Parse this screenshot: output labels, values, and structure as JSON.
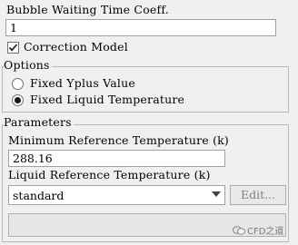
{
  "bubble_waiting": {
    "label": "Bubble Waiting Time Coeff.",
    "value": "1"
  },
  "correction_model": {
    "label": "Correction Model",
    "checked": true
  },
  "options": {
    "title": "Options",
    "radios": [
      {
        "label": "Fixed Yplus Value",
        "selected": false
      },
      {
        "label": "Fixed Liquid Temperature",
        "selected": true
      }
    ]
  },
  "parameters": {
    "title": "Parameters",
    "min_ref_temp": {
      "label": "Minimum Reference Temperature (k)",
      "value": "288.16"
    },
    "liquid_ref_temp": {
      "label": "Liquid Reference Temperature (k)",
      "selected": "standard"
    },
    "edit_button": "Edit..."
  },
  "watermark": {
    "text": "CFD之道"
  }
}
